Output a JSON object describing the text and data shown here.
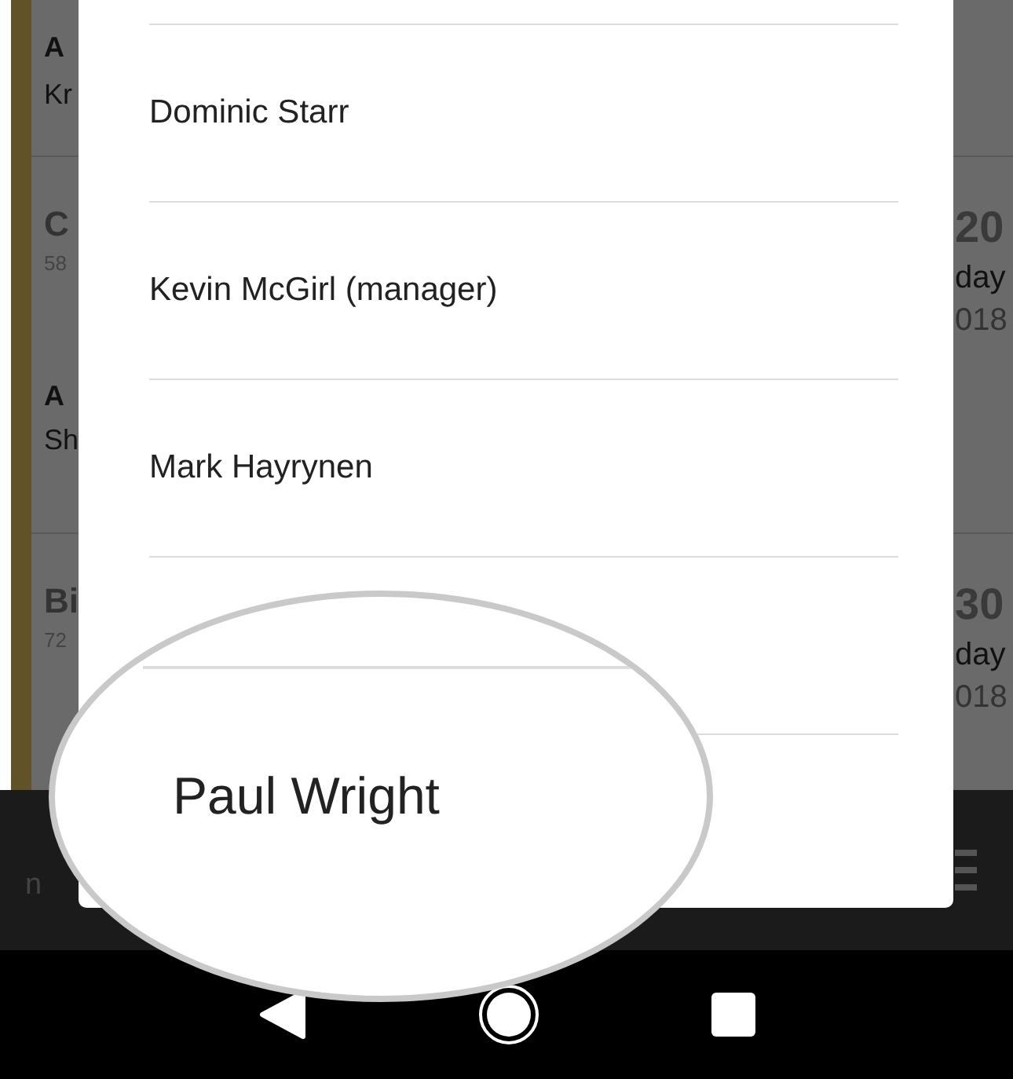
{
  "background_list": {
    "rows": [
      {
        "kind": "contact",
        "title": "A",
        "subtitle": "Kr"
      },
      {
        "kind": "event",
        "title": "C",
        "detail": "58",
        "day_number": "20",
        "weekday": "day",
        "year": "018"
      },
      {
        "kind": "contact",
        "title": "A",
        "subtitle": "Sh"
      },
      {
        "kind": "event",
        "title": "Bi",
        "detail": "72",
        "day_number": "30",
        "weekday": "day",
        "year": "018"
      }
    ]
  },
  "footer": {
    "text": "n"
  },
  "dialog": {
    "items": [
      "Dominic Starr",
      "Kevin McGirl (manager)",
      "Mark Hayrynen"
    ]
  },
  "magnifier": {
    "text": "Paul Wright"
  }
}
